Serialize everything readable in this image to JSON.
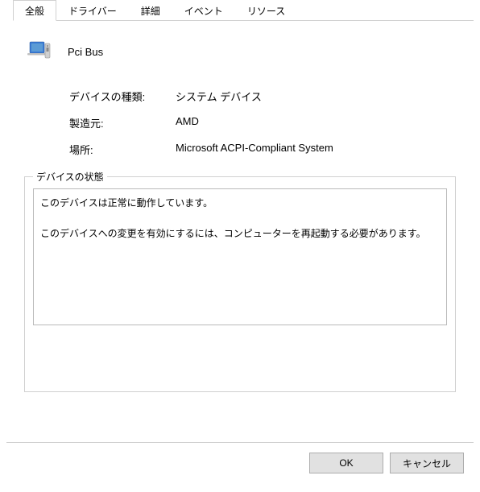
{
  "tabs": {
    "general": "全般",
    "driver": "ドライバー",
    "details": "詳細",
    "events": "イベント",
    "resources": "リソース"
  },
  "device": {
    "name": "Pci Bus"
  },
  "info": {
    "type_label": "デバイスの種類:",
    "type_value": "システム デバイス",
    "manufacturer_label": "製造元:",
    "manufacturer_value": "AMD",
    "location_label": "場所:",
    "location_value": "Microsoft ACPI-Compliant System"
  },
  "status": {
    "legend": "デバイスの状態",
    "text": "このデバイスは正常に動作しています。\n\nこのデバイスへの変更を有効にするには、コンピューターを再起動する必要があります。"
  },
  "buttons": {
    "ok": "OK",
    "cancel": "キャンセル"
  }
}
